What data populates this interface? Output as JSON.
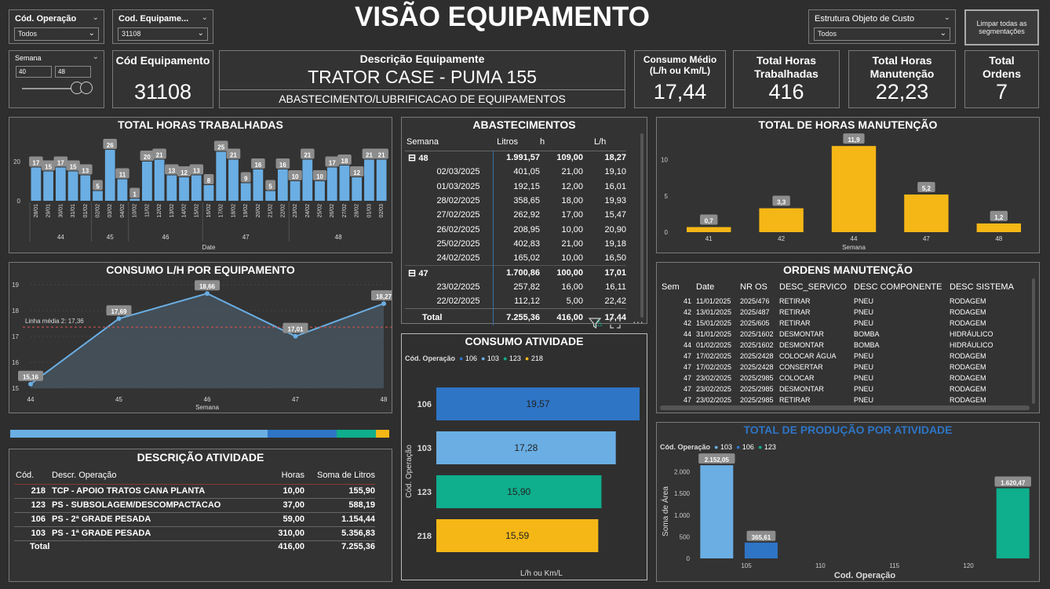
{
  "header": {
    "title": "VISÃO EQUIPAMENTO",
    "clear_button": "Limpar todas as segmentações"
  },
  "slicers": {
    "operacao": {
      "label": "Cód. Operação",
      "value": "Todos"
    },
    "equipamento": {
      "label": "Cod. Equipame...",
      "value": "31108"
    },
    "estrutura": {
      "label": "Estrutura Objeto de Custo",
      "value": "Todos"
    },
    "semana": {
      "label": "Semana",
      "from": "40",
      "to": "48"
    }
  },
  "kpis": {
    "cod_equip": {
      "label": "Cód Equipamento",
      "value": "31108"
    },
    "descricao": {
      "label": "Descrição Equipamente",
      "value": "TRATOR CASE - PUMA 155",
      "sub": "ABASTECIMENTO/LUBRIFICACAO DE EQUIPAMENTOS"
    },
    "consumo": {
      "label": "Consumo Médio (L/h ou Km/L)",
      "value": "17,44"
    },
    "horas_trab": {
      "label": "Total Horas Trabalhadas",
      "value": "416"
    },
    "horas_manut": {
      "label": "Total Horas Manutenção",
      "value": "22,23"
    },
    "ordens": {
      "label": "Total Ordens",
      "value": "7"
    }
  },
  "horas_trabalhadas": {
    "title": "TOTAL HORAS TRABALHADAS",
    "chart_data": {
      "type": "bar",
      "xlabel": "Date",
      "ylim": [
        0,
        28
      ],
      "yticks": [
        "0",
        "20"
      ],
      "x": [
        "28/01/2025",
        "29/01/2025",
        "30/01/2025",
        "31/01/2025",
        "01/02/2025",
        "02/02/2025",
        "03/02/2025",
        "04/02/2025",
        "10/02/2025",
        "11/02/2025",
        "12/02/2025",
        "13/02/2025",
        "14/02/2025",
        "15/02/2025",
        "16/02/2025",
        "17/02/2025",
        "18/02/2025",
        "19/02/2025",
        "20/02/2025",
        "21/02/2025",
        "22/02/2025",
        "23/02/2025",
        "24/02/2025",
        "25/02/2025",
        "26/02/2025",
        "27/02/2025",
        "28/02/2025",
        "01/03/2025",
        "02/03/2025"
      ],
      "values": [
        17,
        15,
        17,
        15,
        13,
        5,
        26,
        11,
        1,
        20,
        21,
        13,
        12,
        13,
        8,
        25,
        21,
        9,
        16,
        5,
        16,
        10,
        21,
        10,
        17,
        18,
        12,
        21,
        21
      ],
      "weeks": [
        {
          "label": "44",
          "from": 0,
          "to": 4
        },
        {
          "label": "45",
          "from": 5,
          "to": 7
        },
        {
          "label": "46",
          "from": 8,
          "to": 13
        },
        {
          "label": "47",
          "from": 14,
          "to": 20
        },
        {
          "label": "48",
          "from": 21,
          "to": 28
        }
      ]
    }
  },
  "consumo_lh": {
    "title": "CONSUMO L/H POR EQUIPAMENTO",
    "chart_data": {
      "type": "line",
      "xlabel": "Semana",
      "x": [
        "44",
        "45",
        "46",
        "47",
        "48"
      ],
      "values": [
        15.16,
        17.69,
        18.66,
        17.01,
        18.27
      ],
      "labels": [
        "15,16",
        "17,69",
        "18,66",
        "17,01",
        "18,27"
      ],
      "ylim": [
        15,
        19
      ],
      "yticks": [
        "15",
        "16",
        "17",
        "18",
        "19"
      ],
      "avg": 17.36,
      "avg_label": "Linha média 2: 17,36"
    }
  },
  "atividade_strip": {
    "colors": [
      "#6aaee3",
      "#2e75c6",
      "#0fae8c",
      "#f5b716"
    ],
    "values": [
      59,
      16,
      9,
      3
    ]
  },
  "descricao_atividade": {
    "title": "DESCRIÇÃO ATIVIDADE",
    "headers": [
      "Cód.",
      "Descr. Operação",
      "Horas",
      "Soma de Litros"
    ],
    "rows": [
      [
        "218",
        "TCP - APOIO TRATOS CANA PLANTA",
        "10,00",
        "155,90"
      ],
      [
        "123",
        "PS - SUBSOLAGEM/DESCOMPACTACAO",
        "37,00",
        "588,19"
      ],
      [
        "106",
        "PS - 2ª GRADE PESADA",
        "59,00",
        "1.154,44"
      ],
      [
        "103",
        "PS - 1ª GRADE PESADA",
        "310,00",
        "5.356,83"
      ]
    ],
    "total": [
      "Total",
      "",
      "416,00",
      "7.255,36"
    ]
  },
  "abastecimentos": {
    "title": "ABASTECIMENTOS",
    "headers": [
      "Semana",
      "Litros",
      "h",
      "L/h"
    ],
    "rows": [
      {
        "group": true,
        "c": [
          "48",
          "1.991,57",
          "109,00",
          "18,27"
        ]
      },
      {
        "c": [
          "02/03/2025",
          "401,05",
          "21,00",
          "19,10"
        ]
      },
      {
        "c": [
          "01/03/2025",
          "192,15",
          "12,00",
          "16,01"
        ]
      },
      {
        "c": [
          "28/02/2025",
          "358,65",
          "18,00",
          "19,93"
        ]
      },
      {
        "c": [
          "27/02/2025",
          "262,92",
          "17,00",
          "15,47"
        ]
      },
      {
        "c": [
          "26/02/2025",
          "208,95",
          "10,00",
          "20,90"
        ]
      },
      {
        "c": [
          "25/02/2025",
          "402,83",
          "21,00",
          "19,18"
        ]
      },
      {
        "c": [
          "24/02/2025",
          "165,02",
          "10,00",
          "16,50"
        ]
      },
      {
        "group": true,
        "c": [
          "47",
          "1.700,86",
          "100,00",
          "17,01"
        ]
      },
      {
        "c": [
          "23/02/2025",
          "257,82",
          "16,00",
          "16,11"
        ]
      },
      {
        "c": [
          "22/02/2025",
          "112,12",
          "5,00",
          "22,42"
        ]
      }
    ],
    "total": [
      "Total",
      "7.255,36",
      "416,00",
      "17,44"
    ]
  },
  "consumo_atividade": {
    "title": "CONSUMO ATIVIDADE",
    "legend_title": "Cód. Operação",
    "ylabel": "Cód. Operação",
    "xlabel": "L/h ou Km/L",
    "chart_data": {
      "type": "bar",
      "orientation": "horizontal",
      "categories": [
        "106",
        "103",
        "123",
        "218"
      ],
      "values": [
        19.57,
        17.28,
        15.9,
        15.59
      ],
      "labels": [
        "19,57",
        "17,28",
        "15,90",
        "15,59"
      ],
      "colors": [
        "#2e75c6",
        "#6aaee3",
        "#0fae8c",
        "#f5b716"
      ],
      "xlim": [
        0,
        19.57
      ]
    }
  },
  "horas_manutencao": {
    "title": "TOTAL DE HORAS MANUTENÇÃO",
    "chart_data": {
      "type": "bar",
      "xlabel": "Semana",
      "categories": [
        "41",
        "42",
        "44",
        "47",
        "48"
      ],
      "values": [
        0.7,
        3.3,
        11.9,
        5.2,
        1.2
      ],
      "labels": [
        "0,7",
        "3,3",
        "11,9",
        "5,2",
        "1,2"
      ],
      "ylim": [
        0,
        13
      ],
      "yticks": [
        "0",
        "5",
        "10"
      ]
    }
  },
  "ordens": {
    "title": "ORDENS MANUTENÇÃO",
    "headers": [
      "Sem",
      "Date",
      "NR OS",
      "DESC_SERVICO",
      "DESC COMPONENTE",
      "DESC SISTEMA"
    ],
    "rows": [
      [
        "41",
        "11/01/2025",
        "2025/476",
        "RETIRAR",
        "PNEU",
        "RODAGEM"
      ],
      [
        "42",
        "13/01/2025",
        "2025/487",
        "RETIRAR",
        "PNEU",
        "RODAGEM"
      ],
      [
        "42",
        "15/01/2025",
        "2025/605",
        "RETIRAR",
        "PNEU",
        "RODAGEM"
      ],
      [
        "44",
        "31/01/2025",
        "2025/1602",
        "DESMONTAR",
        "BOMBA",
        "HIDRÁULICO"
      ],
      [
        "44",
        "01/02/2025",
        "2025/1602",
        "DESMONTAR",
        "BOMBA",
        "HIDRÁULICO"
      ],
      [
        "47",
        "17/02/2025",
        "2025/2428",
        "COLOCAR ÁGUA",
        "PNEU",
        "RODAGEM"
      ],
      [
        "47",
        "17/02/2025",
        "2025/2428",
        "CONSERTAR",
        "PNEU",
        "RODAGEM"
      ],
      [
        "47",
        "23/02/2025",
        "2025/2985",
        "COLOCAR",
        "PNEU",
        "RODAGEM"
      ],
      [
        "47",
        "23/02/2025",
        "2025/2985",
        "DESMONTAR",
        "PNEU",
        "RODAGEM"
      ],
      [
        "47",
        "23/02/2025",
        "2025/2985",
        "RETIRAR",
        "PNEU",
        "RODAGEM"
      ]
    ]
  },
  "producao": {
    "title": "TOTAL DE PRODUÇÃO POR ATIVIDADE",
    "legend_title": "Cód. Operação",
    "chart_data": {
      "type": "bar",
      "xlabel": "Cod. Operação",
      "ylabel": "Soma de Área",
      "x": [
        103,
        106,
        123
      ],
      "values": [
        2152.05,
        365.61,
        1620.47
      ],
      "labels": [
        "2.152,05",
        "365,61",
        "1.620,47"
      ],
      "colors": [
        "#6aaee3",
        "#2e75c6",
        "#0fae8c"
      ],
      "legend": [
        "103",
        "106",
        "123"
      ],
      "xlim": [
        101.5,
        124.5
      ],
      "xticks": [
        "105",
        "110",
        "115",
        "120"
      ],
      "ylim": [
        0,
        2300
      ],
      "yticks": [
        "0",
        "500",
        "1.000",
        "1.500",
        "2.000"
      ]
    }
  }
}
